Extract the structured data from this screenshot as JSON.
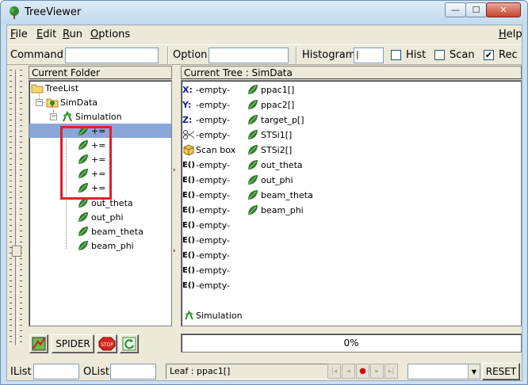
{
  "window": {
    "title": "TreeViewer",
    "min_glyph": "—",
    "max_glyph": "☐",
    "close_glyph": "✕"
  },
  "menu": [
    {
      "key": "F",
      "rest": "ile"
    },
    {
      "key": "E",
      "rest": "dit"
    },
    {
      "key": "R",
      "rest": "un"
    },
    {
      "key": "O",
      "rest": "ptions"
    },
    {
      "key": "H",
      "rest": "elp"
    }
  ],
  "toolbar": {
    "command_label": "Command",
    "command_value": "",
    "option_label": "Option",
    "option_value": "",
    "histogram_label": "Histogram",
    "histogram_value": "|",
    "hist_label": "Hist",
    "hist_checked": false,
    "scan_label": "Scan",
    "scan_checked": false,
    "rec_label": "Rec",
    "rec_checked": true,
    "check_glyph": "✔"
  },
  "left_panel": {
    "header": "Current Folder",
    "items": [
      {
        "label": "TreeList",
        "icon": "folder-icon"
      },
      {
        "label": "SimData",
        "icon": "tree-folder-icon"
      },
      {
        "label": "Simulation",
        "icon": "simulation-icon"
      },
      {
        "label": "+=",
        "icon": "leaf-icon",
        "selected": true
      },
      {
        "label": "+=",
        "icon": "leaf-icon"
      },
      {
        "label": "+=",
        "icon": "leaf-icon"
      },
      {
        "label": "+=",
        "icon": "leaf-icon"
      },
      {
        "label": "+=",
        "icon": "leaf-icon"
      },
      {
        "label": "out_theta",
        "icon": "leaf-icon"
      },
      {
        "label": "out_phi",
        "icon": "leaf-icon"
      },
      {
        "label": "beam_theta",
        "icon": "leaf-icon"
      },
      {
        "label": "beam_phi",
        "icon": "leaf-icon"
      }
    ],
    "expander_minus": "−"
  },
  "right_panel": {
    "header": "Current Tree : SimData",
    "column1": [
      {
        "prefix": "X:",
        "label": "-empty-"
      },
      {
        "prefix": "Y:",
        "label": "-empty-"
      },
      {
        "prefix": "Z:",
        "label": "-empty-"
      },
      {
        "prefix": "cut",
        "label": "-empty-"
      },
      {
        "prefix": "box",
        "label": "Scan box"
      },
      {
        "prefix": "E()",
        "label": "-empty-"
      },
      {
        "prefix": "E()",
        "label": "-empty-"
      },
      {
        "prefix": "E()",
        "label": "-empty-"
      },
      {
        "prefix": "E()",
        "label": "-empty-"
      },
      {
        "prefix": "E()",
        "label": "-empty-"
      },
      {
        "prefix": "E()",
        "label": "-empty-"
      },
      {
        "prefix": "E()",
        "label": "-empty-"
      },
      {
        "prefix": "E()",
        "label": "-empty-"
      },
      {
        "prefix": "E()",
        "label": "-empty-"
      },
      {
        "prefix": "sim",
        "label": "Simulation"
      }
    ],
    "column2": [
      "ppac1[]",
      "ppac2[]",
      "target_p[]",
      "STSi1[]",
      "STSi2[]",
      "out_theta",
      "out_phi",
      "beam_theta",
      "beam_phi"
    ]
  },
  "bottom_buttons": {
    "spider_label": "SPIDER",
    "stop_label": "STOP"
  },
  "progress": {
    "text": "0%",
    "value": 0
  },
  "status": {
    "ilist_label": "IList",
    "ilist_value": "",
    "olist_label": "OList",
    "olist_value": "",
    "leaf_text": "Leaf : ppac1[]",
    "combo_value": "",
    "reset_label": "RESET",
    "nav_first": "|◂",
    "nav_prev": "◂",
    "nav_record": "●",
    "nav_next": "▸",
    "nav_last": "▸|",
    "combo_arrow": "▼",
    "splitter_arrow": "›"
  },
  "colors": {
    "selection": "#8aa6d6",
    "highlight_box": "#e0202a",
    "leaf_green": "#2f7a2a"
  }
}
